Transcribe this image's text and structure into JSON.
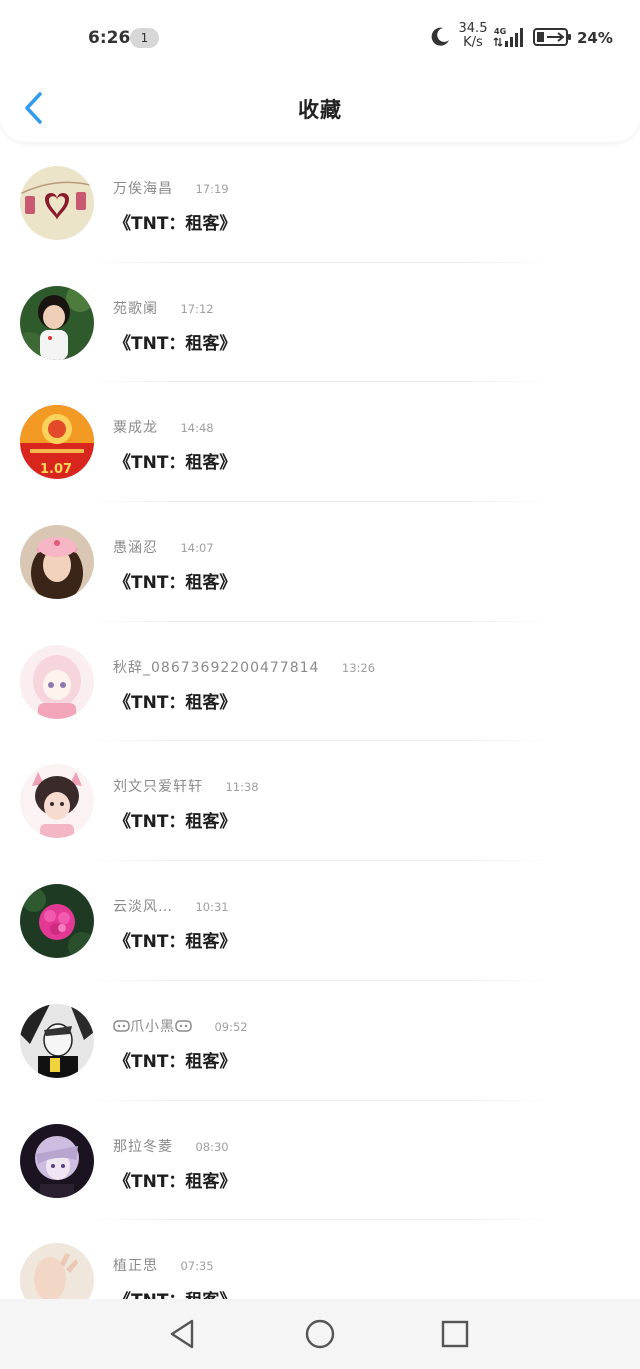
{
  "status_bar": {
    "time": "6:26",
    "notification_count": "1",
    "speed_value": "34.5",
    "speed_unit": "K/s",
    "network_type": "4G",
    "battery_percent": "24%",
    "icons": [
      "moon-icon",
      "signal-icon",
      "battery-charging-icon"
    ]
  },
  "header": {
    "title": "收藏",
    "back_icon": "chevron-left-icon",
    "accent_color": "#2f9cf0"
  },
  "favorites": [
    {
      "name": "万俟海昌",
      "time": "17:19",
      "title": "《TNT：租客》",
      "avatar": "heart-photo-avatar"
    },
    {
      "name": "苑歌阑",
      "time": "17:12",
      "title": "《TNT：租客》",
      "avatar": "child-photo-avatar"
    },
    {
      "name": "粟成龙",
      "time": "14:48",
      "title": "《TNT：租客》",
      "avatar": "red-packet-avatar"
    },
    {
      "name": "愚涵忍",
      "time": "14:07",
      "title": "《TNT：租客》",
      "avatar": "girl-cap-avatar"
    },
    {
      "name": "秋辞_08673692200477814",
      "time": "13:26",
      "title": "《TNT：租客》",
      "avatar": "anime-girl-avatar"
    },
    {
      "name": "刘文只爱轩轩",
      "time": "11:38",
      "title": "《TNT：租客》",
      "avatar": "anime-boy-avatar"
    },
    {
      "name": "云淡风…",
      "time": "10:31",
      "title": "《TNT：租客》",
      "avatar": "flower-avatar"
    },
    {
      "name": "爪小黑",
      "time": "09:52",
      "title": "《TNT：租客》",
      "avatar": "manga-avatar"
    },
    {
      "name": "那拉冬菱",
      "time": "08:30",
      "title": "《TNT：租客》",
      "avatar": "purple-anime-avatar"
    },
    {
      "name": "植正思",
      "time": "07:35",
      "title": "《TNT：租客》",
      "avatar": "hand-photo-avatar"
    }
  ],
  "system_nav": {
    "icons": [
      "back-triangle-icon",
      "home-circle-icon",
      "recents-square-icon"
    ]
  }
}
